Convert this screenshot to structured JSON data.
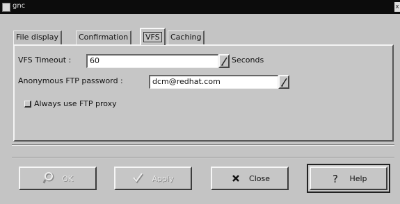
{
  "window": {
    "title": "gnc",
    "close_glyph": "x"
  },
  "tabs": [
    {
      "label": "File display",
      "active": false
    },
    {
      "label": "Confirmation",
      "active": false
    },
    {
      "label": "VFS",
      "active": true
    },
    {
      "label": "Caching",
      "active": false
    }
  ],
  "vfs": {
    "timeout_label": "VFS Timeout :",
    "timeout_value": "60",
    "timeout_unit": "Seconds",
    "ftp_password_label": "Anonymous FTP password :",
    "ftp_password_value": "dcm@redhat.com",
    "proxy_checkbox_label": "Always use FTP proxy",
    "proxy_checked": false
  },
  "buttons": {
    "ok": {
      "label": "OK",
      "icon": "ok-icon",
      "enabled": false
    },
    "apply": {
      "label": "Apply",
      "icon": "apply-check-icon",
      "enabled": false
    },
    "close": {
      "label": "Close",
      "icon": "close-x-icon",
      "enabled": true
    },
    "help": {
      "label": "Help",
      "icon": "help-question-icon",
      "enabled": true
    }
  }
}
